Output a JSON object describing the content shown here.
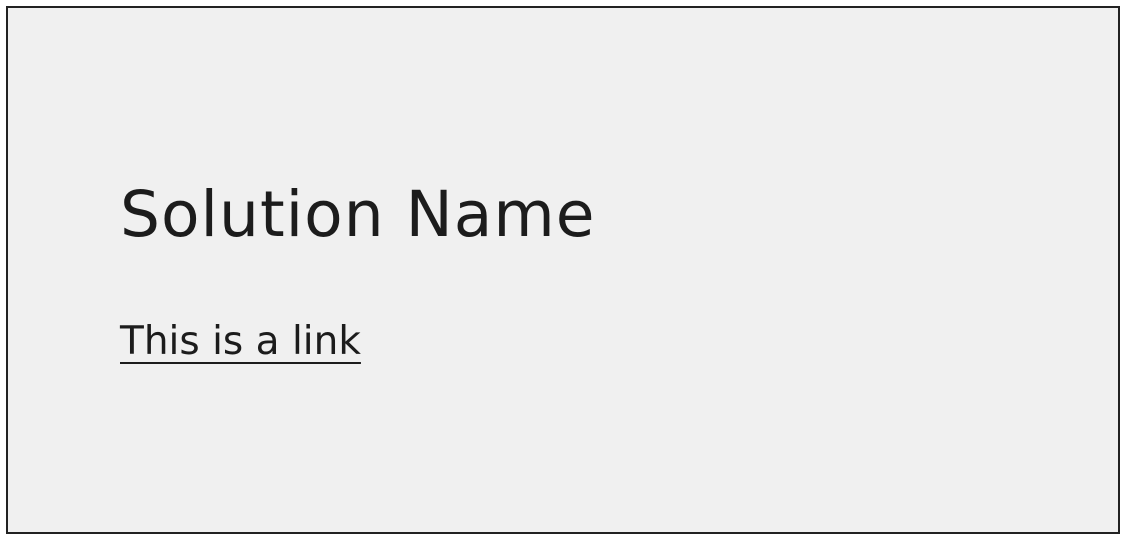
{
  "card": {
    "title": "Solution Name",
    "link_label": "This is a link"
  },
  "colors": {
    "background": "#f0f0f0",
    "border": "#222222",
    "text": "#1c1c1c"
  }
}
